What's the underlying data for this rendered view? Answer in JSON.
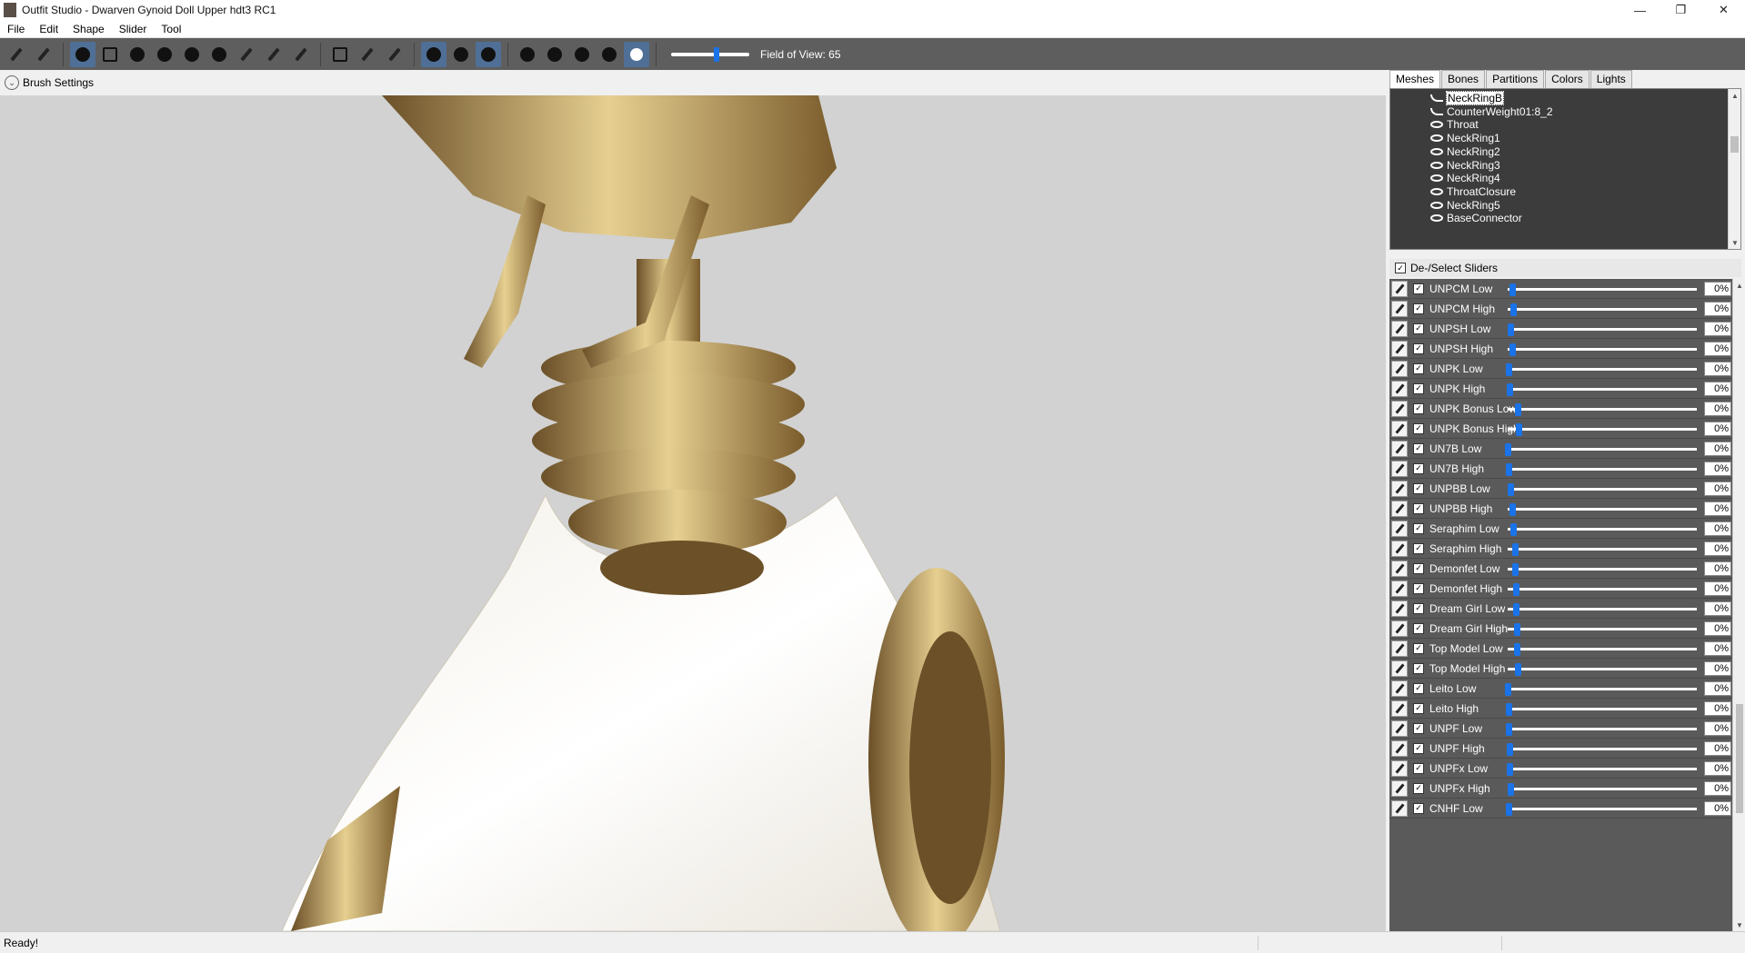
{
  "window": {
    "title": "Outfit Studio - Dwarven Gynoid Doll Upper hdt3 RC1",
    "minimize_icon": "minimize-icon",
    "restore_icon": "restore-icon",
    "close_icon": "close-icon"
  },
  "menu": [
    "File",
    "Edit",
    "Shape",
    "Slider",
    "Tool"
  ],
  "toolbar": {
    "fov_label": "Field of View: 65",
    "fov_value": 65
  },
  "brush": {
    "label": "Brush Settings"
  },
  "panel": {
    "tabs": [
      "Meshes",
      "Bones",
      "Partitions",
      "Colors",
      "Lights"
    ],
    "active_tab": "Meshes",
    "meshes": [
      {
        "name": "NeckRingB",
        "selected": true,
        "visible": false
      },
      {
        "name": "CounterWeight01:8_2",
        "selected": false,
        "visible": false
      },
      {
        "name": "Throat",
        "selected": false,
        "visible": true
      },
      {
        "name": "NeckRing1",
        "selected": false,
        "visible": true
      },
      {
        "name": "NeckRing2",
        "selected": false,
        "visible": true
      },
      {
        "name": "NeckRing3",
        "selected": false,
        "visible": true
      },
      {
        "name": "NeckRing4",
        "selected": false,
        "visible": true
      },
      {
        "name": "ThroatClosure",
        "selected": false,
        "visible": true
      },
      {
        "name": "NeckRing5",
        "selected": false,
        "visible": true
      },
      {
        "name": "BaseConnector",
        "selected": false,
        "visible": true
      }
    ],
    "deselect_label": "De-/Select Sliders",
    "sliders": [
      {
        "name": "UNPCM Low",
        "value": "0%",
        "pos": 0.0
      },
      {
        "name": "UNPCM High",
        "value": "0%",
        "pos": 0.0
      },
      {
        "name": "UNPSH Low",
        "value": "0%",
        "pos": 0.0
      },
      {
        "name": "UNPSH High",
        "value": "0%",
        "pos": 0.0
      },
      {
        "name": "UNPK Low",
        "value": "0%",
        "pos": 0.0
      },
      {
        "name": "UNPK High",
        "value": "0%",
        "pos": 0.0
      },
      {
        "name": "UNPK Bonus Low",
        "value": "0%",
        "pos": 0.0
      },
      {
        "name": "UNPK Bonus High",
        "value": "0%",
        "pos": 0.0
      },
      {
        "name": "UN7B Low",
        "value": "0%",
        "pos": 0.0
      },
      {
        "name": "UN7B High",
        "value": "0%",
        "pos": 0.0
      },
      {
        "name": "UNPBB Low",
        "value": "0%",
        "pos": 0.0
      },
      {
        "name": "UNPBB High",
        "value": "0%",
        "pos": 0.0
      },
      {
        "name": "Seraphim Low",
        "value": "0%",
        "pos": 0.0
      },
      {
        "name": "Seraphim High",
        "value": "0%",
        "pos": 0.0
      },
      {
        "name": "Demonfet Low",
        "value": "0%",
        "pos": 0.0
      },
      {
        "name": "Demonfet High",
        "value": "0%",
        "pos": 0.0
      },
      {
        "name": "Dream Girl Low",
        "value": "0%",
        "pos": 0.0
      },
      {
        "name": "Dream Girl High",
        "value": "0%",
        "pos": 0.0
      },
      {
        "name": "Top Model Low",
        "value": "0%",
        "pos": 0.0
      },
      {
        "name": "Top Model High",
        "value": "0%",
        "pos": 0.0
      },
      {
        "name": "Leito Low",
        "value": "0%",
        "pos": 0.0
      },
      {
        "name": "Leito High",
        "value": "0%",
        "pos": 0.0
      },
      {
        "name": "UNPF Low",
        "value": "0%",
        "pos": 0.0
      },
      {
        "name": "UNPF High",
        "value": "0%",
        "pos": 0.0
      },
      {
        "name": "UNPFx Low",
        "value": "0%",
        "pos": 0.0
      },
      {
        "name": "UNPFx High",
        "value": "0%",
        "pos": 0.0
      },
      {
        "name": "CNHF Low",
        "value": "0%",
        "pos": 0.0
      }
    ]
  },
  "status": {
    "text": "Ready!"
  },
  "colors": {
    "toolbar_bg": "#5e5e5e",
    "slider_thumb": "#1a73e8",
    "viewport_bg": "#d2d2d2",
    "mesh_list_bg": "#3c3c3c"
  }
}
